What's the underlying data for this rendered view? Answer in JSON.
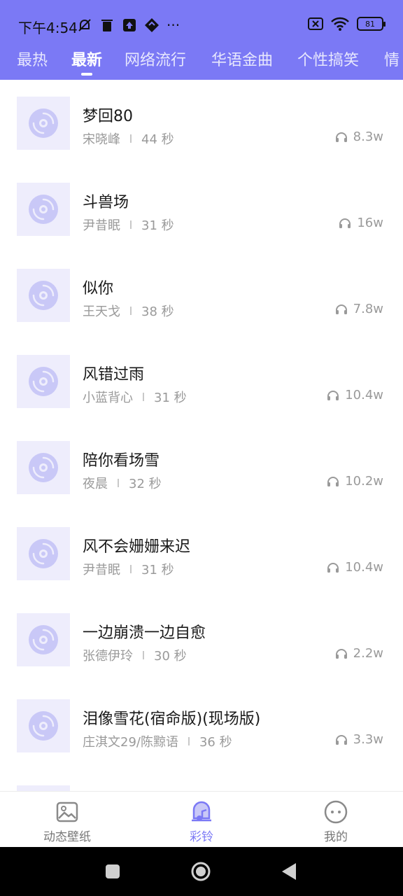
{
  "status_bar": {
    "time": "下午4:54",
    "more": "···",
    "battery": "81"
  },
  "tabs": [
    {
      "label": "最热",
      "active": false
    },
    {
      "label": "最新",
      "active": true
    },
    {
      "label": "网络流行",
      "active": false
    },
    {
      "label": "华语金曲",
      "active": false
    },
    {
      "label": "个性搞笑",
      "active": false
    },
    {
      "label": "情",
      "active": false
    }
  ],
  "songs": [
    {
      "title": "梦回80",
      "artist": "宋晓峰",
      "duration": "44 秒",
      "plays": "8.3w"
    },
    {
      "title": "斗兽场",
      "artist": "尹昔眠",
      "duration": "31 秒",
      "plays": "16w"
    },
    {
      "title": "似你",
      "artist": "王天戈",
      "duration": "38 秒",
      "plays": "7.8w"
    },
    {
      "title": "风错过雨",
      "artist": "小蓝背心",
      "duration": "31 秒",
      "plays": "10.4w"
    },
    {
      "title": "陪你看场雪",
      "artist": "夜晨",
      "duration": "32 秒",
      "plays": "10.2w"
    },
    {
      "title": "风不会姗姗来迟",
      "artist": "尹昔眠",
      "duration": "31 秒",
      "plays": "10.4w"
    },
    {
      "title": "一边崩溃一边自愈",
      "artist": "张德伊玲",
      "duration": "30 秒",
      "plays": "2.2w"
    },
    {
      "title": "泪像雪花(宿命版)(现场版)",
      "artist": "庄淇文29/陈黥语",
      "duration": "36 秒",
      "plays": "3.3w"
    }
  ],
  "bottom_nav": [
    {
      "label": "动态壁纸",
      "icon": "image-icon",
      "active": false
    },
    {
      "label": "彩铃",
      "icon": "bell-music-icon",
      "active": true
    },
    {
      "label": "我的",
      "icon": "smiley-icon",
      "active": false
    }
  ],
  "colors": {
    "accent": "#7b79f5",
    "cover_bg": "#eeedfc",
    "cover_disc": "#c9c8f7"
  }
}
